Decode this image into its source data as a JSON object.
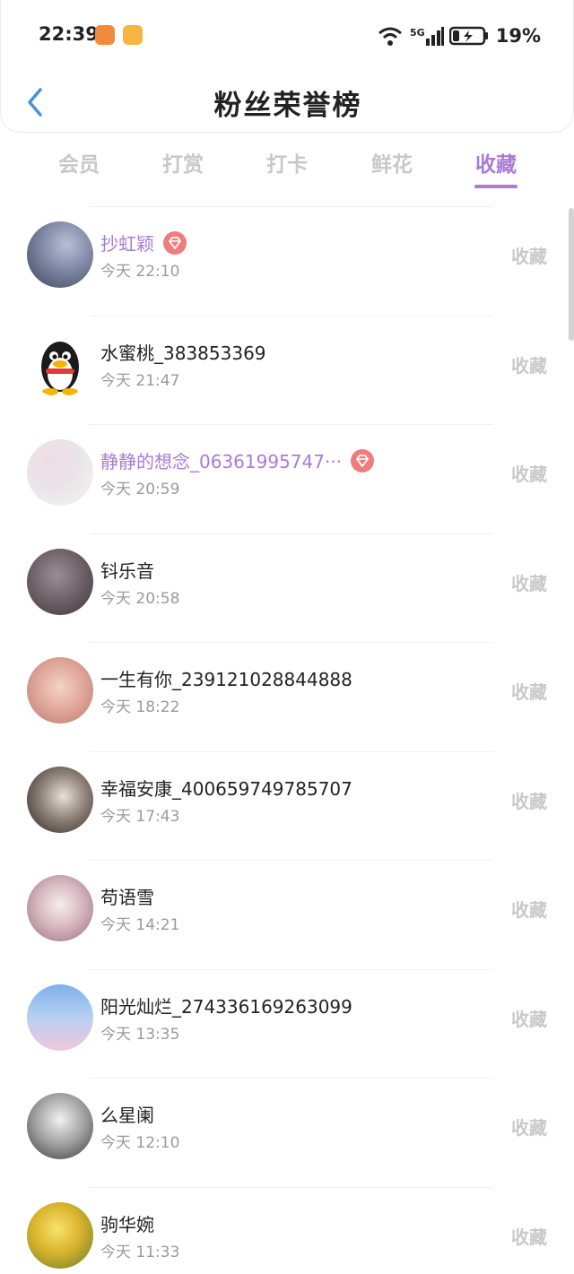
{
  "status": {
    "time": "22:39",
    "battery": "19%",
    "network": "5G",
    "wifi_sub": "6"
  },
  "header": {
    "title": "粉丝荣誉榜"
  },
  "tabs": [
    {
      "label": "会员",
      "active": false
    },
    {
      "label": "打赏",
      "active": false
    },
    {
      "label": "打卡",
      "active": false
    },
    {
      "label": "鲜花",
      "active": false
    },
    {
      "label": "收藏",
      "active": true
    }
  ],
  "accent_color": "#a87bd6",
  "rows": [
    {
      "name": "抄虹颖",
      "time": "今天 22:10",
      "action": "收藏",
      "vip": true
    },
    {
      "name": "水蜜桃_383853369",
      "time": "今天 21:47",
      "action": "收藏",
      "vip": false
    },
    {
      "name": "静静的想念_06361995747···",
      "time": "今天 20:59",
      "action": "收藏",
      "vip": true
    },
    {
      "name": "钭乐音",
      "time": "今天 20:58",
      "action": "收藏",
      "vip": false
    },
    {
      "name": "一生有你_239121028844888",
      "time": "今天 18:22",
      "action": "收藏",
      "vip": false
    },
    {
      "name": "幸福安康_400659749785707",
      "time": "今天 17:43",
      "action": "收藏",
      "vip": false
    },
    {
      "name": "苟语雪",
      "time": "今天 14:21",
      "action": "收藏",
      "vip": false
    },
    {
      "name": "阳光灿烂_274336169263099",
      "time": "今天 13:35",
      "action": "收藏",
      "vip": false
    },
    {
      "name": "么星阑",
      "time": "今天 12:10",
      "action": "收藏",
      "vip": false
    },
    {
      "name": "驹华婉",
      "time": "今天 11:33",
      "action": "收藏",
      "vip": false
    }
  ]
}
